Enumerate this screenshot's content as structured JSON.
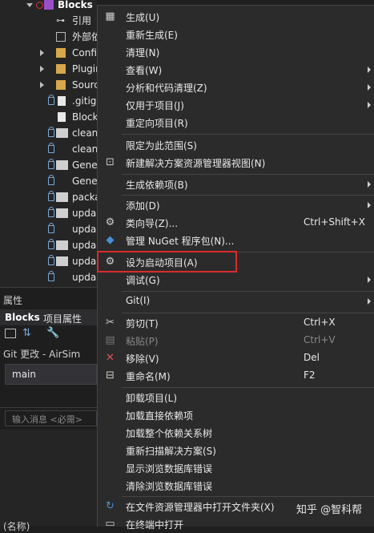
{
  "tree": {
    "root": "Blocks",
    "items": [
      {
        "label": "引用"
      },
      {
        "label": "外部依"
      },
      {
        "label": "Confi"
      },
      {
        "label": "Plugir"
      },
      {
        "label": "Sourc"
      },
      {
        "label": ".gitig"
      },
      {
        "label": "Block"
      },
      {
        "label": "clean"
      },
      {
        "label": "clean"
      },
      {
        "label": "Gene"
      },
      {
        "label": "Gene"
      },
      {
        "label": "packa"
      },
      {
        "label": "upda"
      },
      {
        "label": "upda"
      },
      {
        "label": "upda"
      },
      {
        "label": "upda"
      },
      {
        "label": "upda"
      }
    ]
  },
  "props": {
    "title": "属性",
    "object": "Blocks",
    "object_suffix": "项目属性",
    "git_changes": "Git 更改 - AirSim",
    "branch": "main",
    "message_placeholder": "输入消息 <必需>",
    "bottom_label": "(名称)"
  },
  "menu": {
    "build": "生成(U)",
    "rebuild": "重新生成(E)",
    "clean": "清理(N)",
    "view": "查看(W)",
    "analyze": "分析和代码清理(Z)",
    "project_only": "仅用于项目(J)",
    "retarget": "重定向项目(R)",
    "scope_to_this": "限定为此范围(S)",
    "new_explorer_view": "新建解决方案资源管理器视图(N)",
    "build_dependencies": "生成依赖项(B)",
    "add": "添加(D)",
    "class_wizard": "类向导(Z)...",
    "class_wizard_shortcut": "Ctrl+Shift+X",
    "manage_nuget": "管理 NuGet 程序包(N)...",
    "set_startup": "设为启动项目(A)",
    "debug": "调试(G)",
    "git": "Git(I)",
    "cut": "剪切(T)",
    "cut_shortcut": "Ctrl+X",
    "paste": "粘贴(P)",
    "paste_shortcut": "Ctrl+V",
    "remove": "移除(V)",
    "remove_shortcut": "Del",
    "rename": "重命名(M)",
    "rename_shortcut": "F2",
    "unload": "卸载项目(L)",
    "load_direct": "加载直接依赖项",
    "load_tree": "加载整个依赖关系树",
    "rescan": "重新扫描解决方案(S)",
    "show_db_errors": "显示浏览数据库错误",
    "clear_db_errors": "清除浏览数据库错误",
    "open_in_explorer": "在文件资源管理器中打开文件夹(X)",
    "open_in_terminal": "在终端中打开"
  },
  "watermark": "知乎 @智科帮",
  "colors": {
    "highlight": "#d92b2b",
    "menu_bg": "#2b2b2b",
    "tree_bg": "#252526"
  }
}
